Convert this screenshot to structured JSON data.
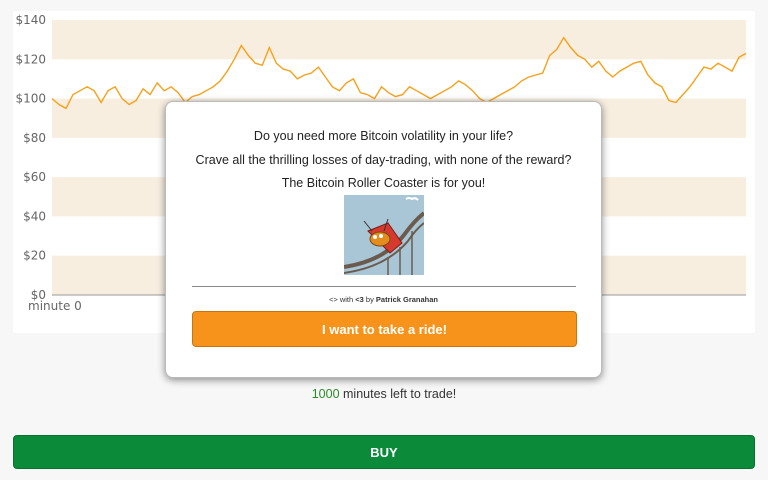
{
  "colors": {
    "line": "#f7a11a",
    "band": "#f8eee0",
    "buy": "#0b8a3a",
    "ride": "#f7931a",
    "count": "#2a8a2a"
  },
  "chart_data": {
    "type": "line",
    "title": "",
    "xlabel": "",
    "ylabel": "",
    "x_tick_labels": [
      "minute 0"
    ],
    "y_tick_labels": [
      "$140",
      "$120",
      "$100",
      "$80",
      "$60",
      "$40",
      "$20",
      "$0"
    ],
    "ylim": [
      0,
      140
    ],
    "grid": "alternating horizontal bands",
    "series": [
      {
        "values": [
          100,
          97,
          95,
          102,
          104,
          106,
          104,
          98,
          104,
          106,
          100,
          97,
          99,
          105,
          102,
          108,
          104,
          106,
          103,
          98,
          101,
          102,
          104,
          106,
          109,
          114,
          120,
          127,
          122,
          118,
          117,
          126,
          118,
          115,
          114,
          110,
          112,
          113,
          116,
          111,
          106,
          104,
          108,
          110,
          103,
          102,
          100,
          106,
          103,
          101,
          102,
          106,
          104,
          102,
          100,
          102,
          104,
          106,
          109,
          107,
          104,
          100,
          98,
          100,
          102,
          104,
          106,
          109,
          111,
          112,
          113,
          122,
          125,
          131,
          126,
          122,
          120,
          116,
          119,
          114,
          111,
          114,
          116,
          118,
          119,
          112,
          108,
          106,
          99,
          98,
          102,
          106,
          111,
          116,
          115,
          118,
          116,
          114,
          121,
          123
        ]
      }
    ]
  },
  "modal": {
    "line1": "Do you need more Bitcoin volatility in your life?",
    "line2": "Crave all the thrilling losses of day-trading, with none of the reward?",
    "line3": "The Bitcoin Roller Coaster is for you!",
    "credit_prefix": "<> with ",
    "credit_heart": "<3",
    "credit_by": " by ",
    "credit_author": "Patrick Granahan",
    "ride_button": "I want to take a ride!"
  },
  "timer": {
    "count": "1000",
    "suffix": " minutes left to trade!"
  },
  "buy_button": "BUY"
}
